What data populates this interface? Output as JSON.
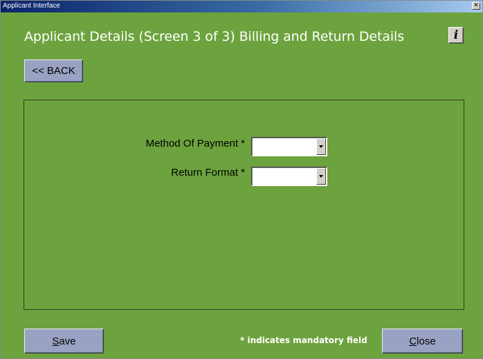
{
  "window": {
    "title": "Applicant Interface",
    "close_glyph": "✕"
  },
  "header": {
    "title": "Applicant Details (Screen 3 of 3) Billing and Return Details",
    "info_button_glyph": "i"
  },
  "nav": {
    "back_label": "<< BACK"
  },
  "form": {
    "fields": [
      {
        "label": "Method Of Payment *",
        "value": ""
      },
      {
        "label": "Return Format *",
        "value": ""
      }
    ]
  },
  "footer": {
    "save_mnemonic": "S",
    "save_rest": "ave",
    "mandatory_note": "* indicates mandatory field",
    "close_mnemonic": "C",
    "close_rest": "lose"
  },
  "colors": {
    "background": "#6da33e",
    "button": "#9aa2c3",
    "titlebar": "#0a246a"
  }
}
